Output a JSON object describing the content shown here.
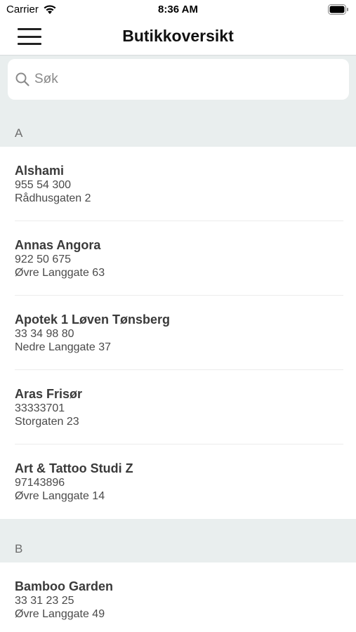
{
  "status_bar": {
    "carrier": "Carrier",
    "time": "8:36 AM"
  },
  "nav": {
    "title": "Butikkoversikt",
    "menu_icon": "hamburger-menu-icon"
  },
  "search": {
    "placeholder": "Søk",
    "value": "",
    "icon": "search-icon"
  },
  "sections": [
    {
      "letter": "A",
      "stores": [
        {
          "name": "Alshami",
          "phone": "955 54 300",
          "address": "Rådhusgaten 2"
        },
        {
          "name": "Annas Angora",
          "phone": "922 50 675",
          "address": "Øvre Langgate 63"
        },
        {
          "name": "Apotek 1 Løven Tønsberg",
          "phone": "33 34 98 80",
          "address": "Nedre Langgate 37"
        },
        {
          "name": "Aras Frisør",
          "phone": "33333701",
          "address": "Storgaten 23"
        },
        {
          "name": "Art & Tattoo Studi Z",
          "phone": "97143896",
          "address": "Øvre Langgate 14"
        }
      ]
    },
    {
      "letter": "B",
      "stores": [
        {
          "name": "Bamboo Garden",
          "phone": "33 31 23 25",
          "address": "Øvre Langgate 49"
        }
      ]
    }
  ],
  "colors": {
    "section_background": "#e9eeee",
    "title_text": "#111111",
    "secondary_text": "#4a4a4a"
  }
}
